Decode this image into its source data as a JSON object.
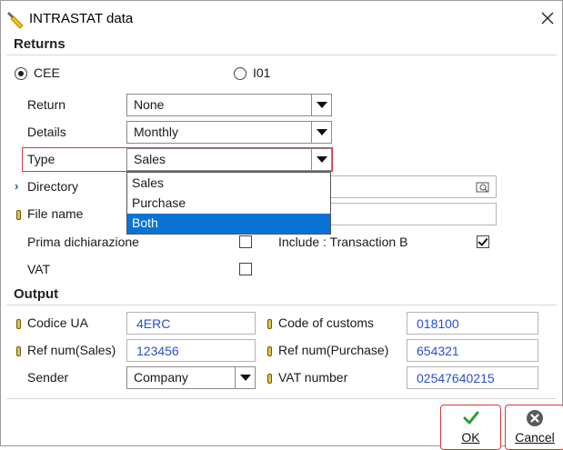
{
  "window": {
    "title": "INTRASTAT data",
    "icons": {
      "app": "wrench-icon",
      "close": "close-icon"
    }
  },
  "returns": {
    "section_title": "Returns",
    "radio_cee": {
      "label": "CEE",
      "checked": true
    },
    "radio_i01": {
      "label": "I01",
      "checked": false
    },
    "return_field": {
      "label": "Return",
      "value": "None"
    },
    "details_field": {
      "label": "Details",
      "value": "Monthly"
    },
    "type_field": {
      "label": "Type",
      "value": "Sales",
      "options": [
        "Sales",
        "Purchase",
        "Both"
      ],
      "highlighted_option": "Both"
    },
    "directory_field": {
      "label": "Directory",
      "value": ""
    },
    "file_name_field": {
      "label": "File name",
      "value": ""
    },
    "prima_dichiarazione": {
      "label": "Prima dichiarazione",
      "checked": false
    },
    "include_transaction_b": {
      "label": "Include : Transaction B",
      "checked": true
    },
    "vat": {
      "label": "VAT",
      "checked": false
    }
  },
  "output": {
    "section_title": "Output",
    "codice_ua": {
      "label": "Codice UA",
      "value": "4ERC"
    },
    "code_of_customs": {
      "label": "Code of customs",
      "value": "018100"
    },
    "ref_num_sales": {
      "label": "Ref num(Sales)",
      "value": "123456"
    },
    "ref_num_purchase": {
      "label": "Ref num(Purchase)",
      "value": "654321"
    },
    "sender": {
      "label": "Sender",
      "value": "Company"
    },
    "vat_number": {
      "label": "VAT number",
      "value": "02547640215"
    }
  },
  "buttons": {
    "ok": {
      "label": "OK",
      "icon": "checkmark-icon"
    },
    "cancel": {
      "label": "Cancel",
      "icon": "cancel-icon"
    }
  },
  "colors": {
    "accent": "#0a73d6",
    "focus_border": "#d43b3b",
    "value_text": "#2a4fd1",
    "ok_green": "#2e9e3a"
  }
}
